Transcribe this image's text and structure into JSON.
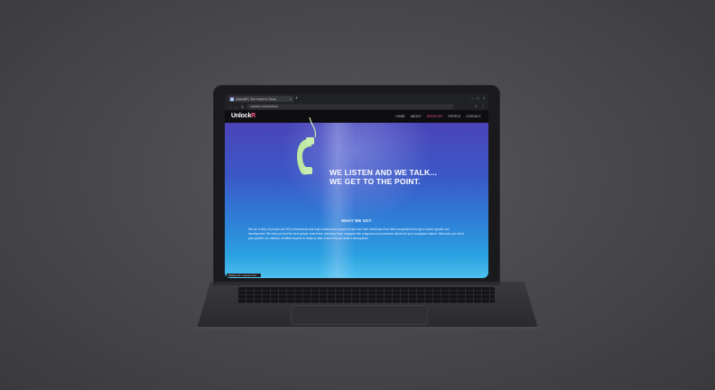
{
  "browser": {
    "tab_title": "UnlockR | The Voice to Grow",
    "tab_close": "×",
    "new_tab": "+",
    "window_controls": [
      "–",
      "□",
      "×"
    ],
    "nav_buttons": [
      "←",
      "→",
      "↻"
    ],
    "url": "unlockr.com/contact",
    "extensions": [
      "☆",
      "⋮"
    ]
  },
  "site": {
    "logo_main": "Unlock",
    "logo_accent": "R",
    "menu": [
      {
        "label": "HOME",
        "active": false
      },
      {
        "label": "ABOUT",
        "active": false
      },
      {
        "label": "SERVICES",
        "active": true
      },
      {
        "label": "PEOPLE",
        "active": false
      },
      {
        "label": "CONTACT",
        "active": false
      }
    ]
  },
  "hero": {
    "headline_line1": "WE LISTEN AND WE TALK...",
    "headline_line2": "WE GET TO THE POINT.",
    "section_title": "WHAT WE DO?",
    "body": "We are a team of people and HR professionals that helps businesses support people and their individuals from talent acquisition through to career growth and development. We help you find the best people, train them, and keep them engaged with programs and processes tailored to your workplace culture. Wherever you are in your growth, our network of skilled experts is ready to step in and help you build a strong team."
  },
  "statusbar": "Waiting for unlockr.com..."
}
